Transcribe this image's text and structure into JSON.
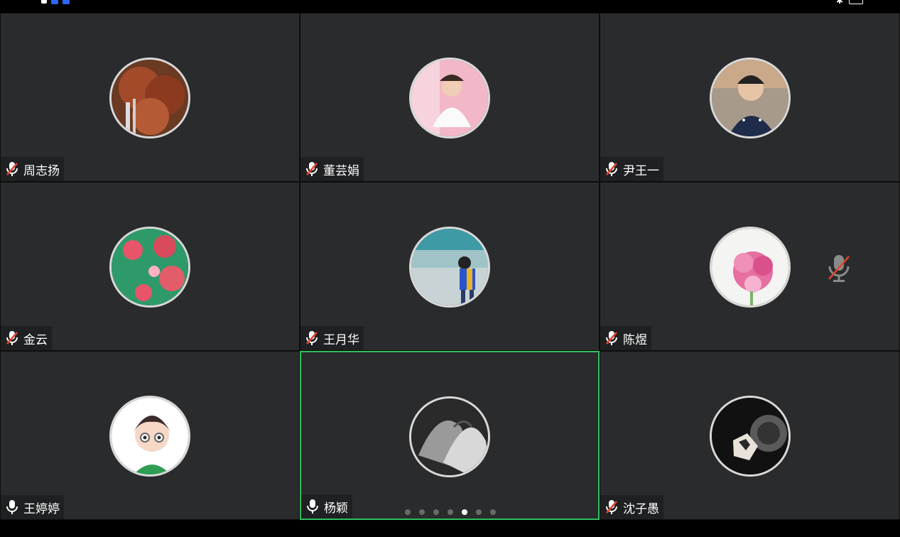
{
  "participants": [
    {
      "name": "周志扬",
      "muted": true
    },
    {
      "name": "董芸娟",
      "muted": true
    },
    {
      "name": "尹王一",
      "muted": true
    },
    {
      "name": "金云",
      "muted": true
    },
    {
      "name": "王月华",
      "muted": true
    },
    {
      "name": "陈煜",
      "muted": true,
      "center_muted_indicator": true
    },
    {
      "name": "王婷婷",
      "muted": false
    },
    {
      "name": "杨颖",
      "muted": false,
      "active_speaker": true
    },
    {
      "name": "沈子愚",
      "muted": true
    }
  ],
  "pager": {
    "total": 7,
    "current": 5
  },
  "colors": {
    "tile_bg": "#2a2b2d",
    "active_border": "#2ebf5f",
    "mute_red": "#e0452f"
  }
}
